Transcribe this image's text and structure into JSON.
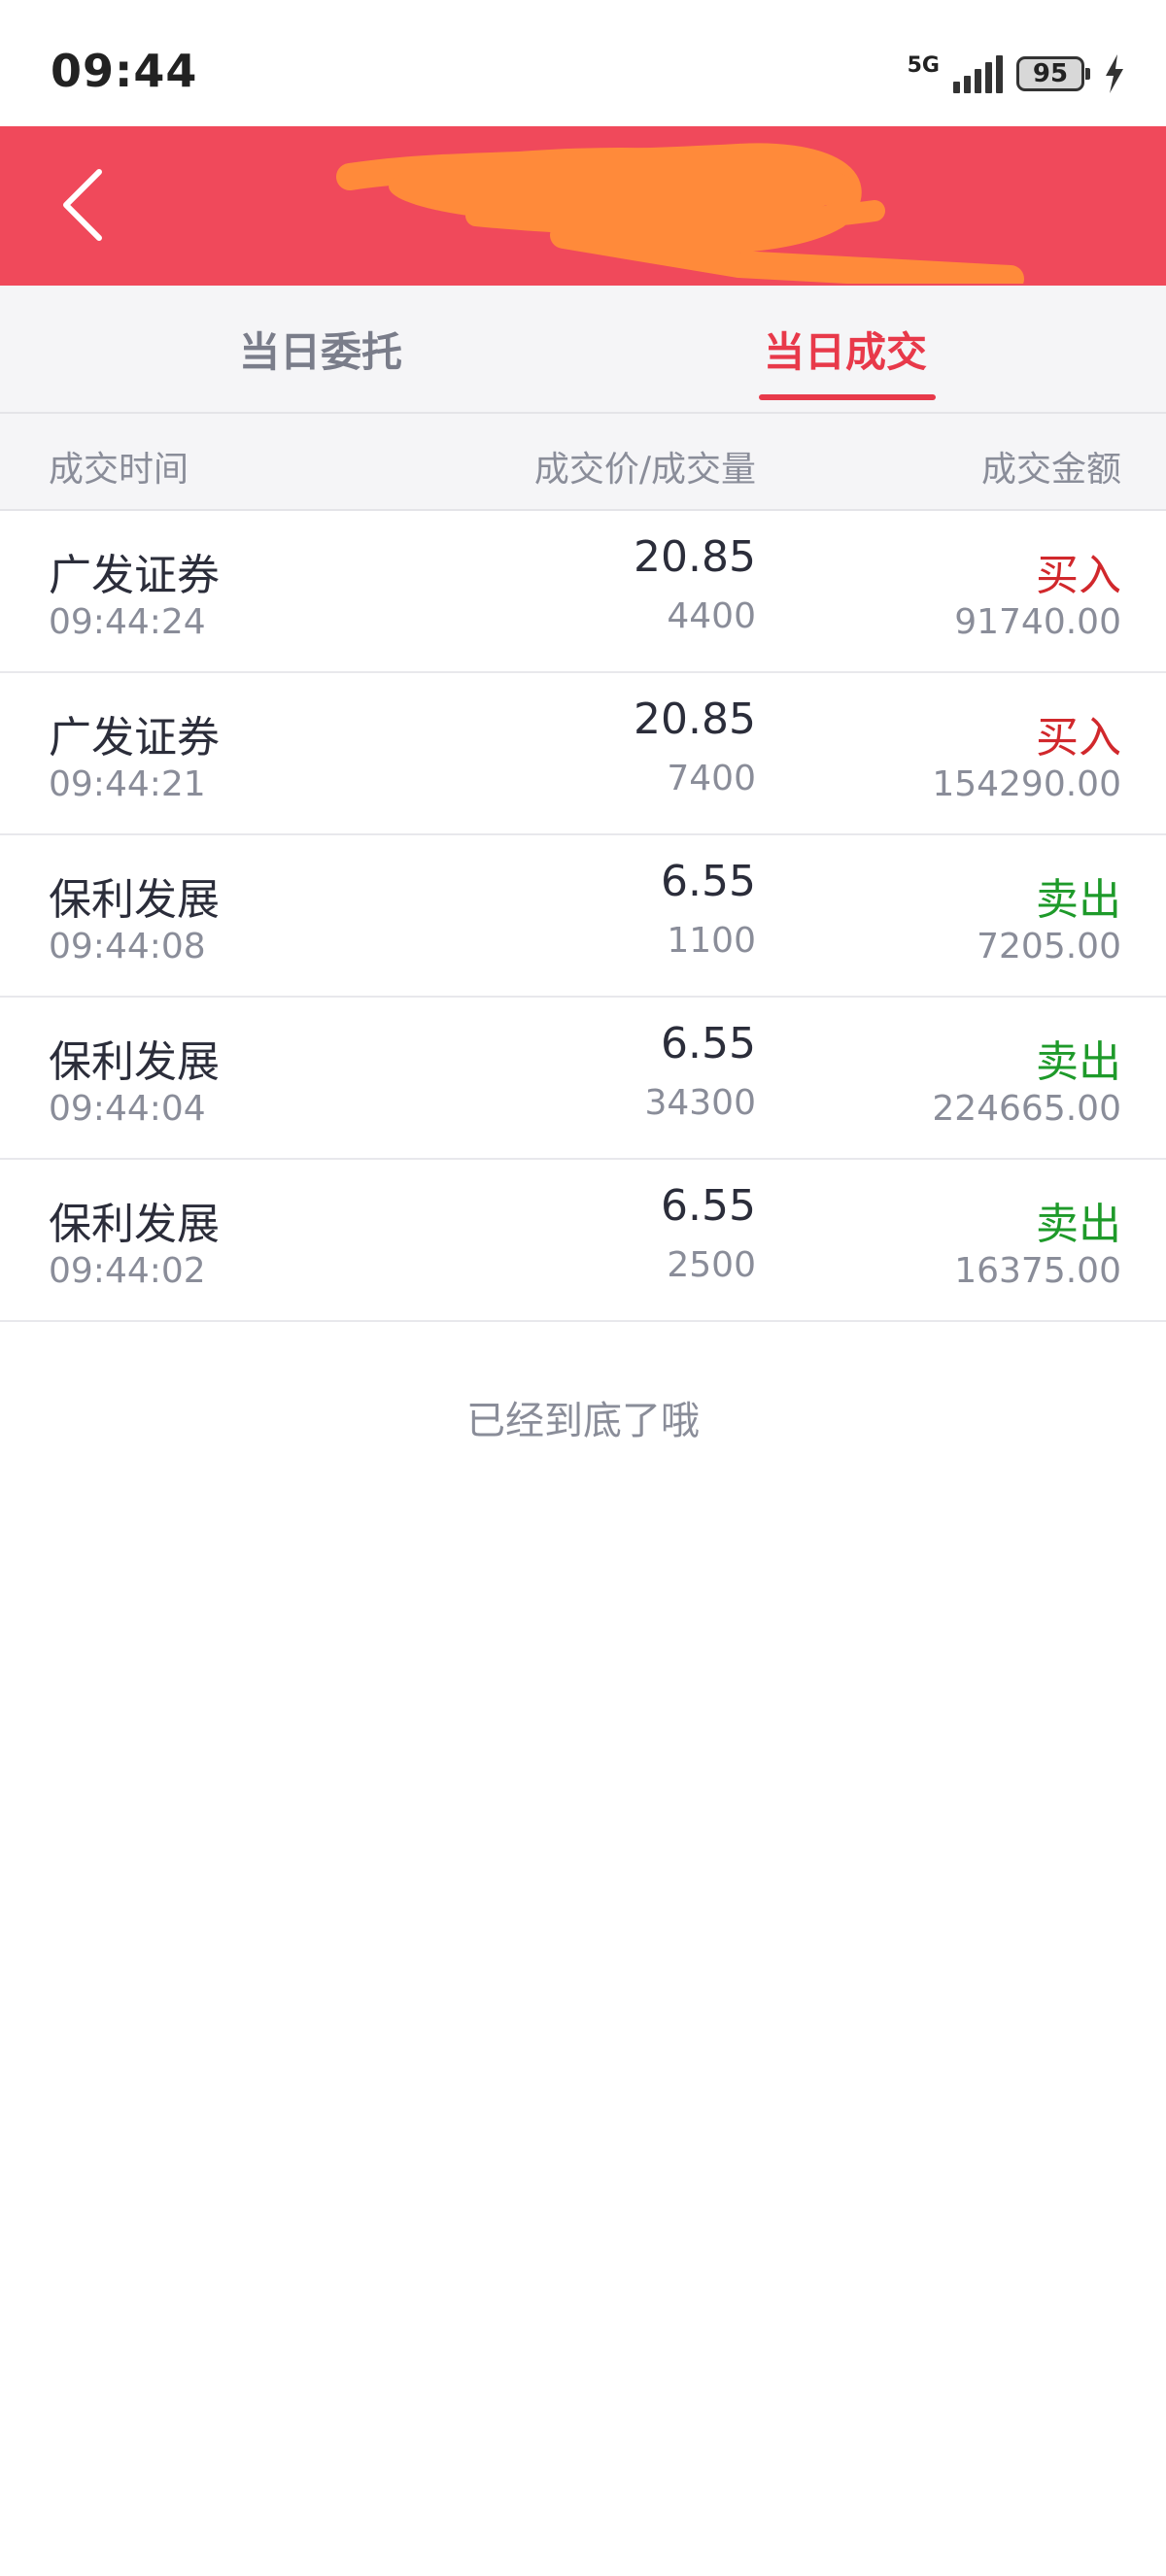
{
  "status_bar": {
    "time": "09:44",
    "network": "5G",
    "battery": "95"
  },
  "tabs": [
    {
      "label": "当日委托",
      "active": false
    },
    {
      "label": "当日成交",
      "active": true
    }
  ],
  "columns": {
    "time": "成交时间",
    "price_qty": "成交价/成交量",
    "amount": "成交金额"
  },
  "trades": [
    {
      "name": "广发证券",
      "time": "09:44:24",
      "price": "20.85",
      "qty": "4400",
      "side": "买入",
      "side_type": "buy",
      "amount": "91740.00"
    },
    {
      "name": "广发证券",
      "time": "09:44:21",
      "price": "20.85",
      "qty": "7400",
      "side": "买入",
      "side_type": "buy",
      "amount": "154290.00"
    },
    {
      "name": "保利发展",
      "time": "09:44:08",
      "price": "6.55",
      "qty": "1100",
      "side": "卖出",
      "side_type": "sell",
      "amount": "7205.00"
    },
    {
      "name": "保利发展",
      "time": "09:44:04",
      "price": "6.55",
      "qty": "34300",
      "side": "卖出",
      "side_type": "sell",
      "amount": "224665.00"
    },
    {
      "name": "保利发展",
      "time": "09:44:02",
      "price": "6.55",
      "qty": "2500",
      "side": "卖出",
      "side_type": "sell",
      "amount": "16375.00"
    }
  ],
  "footer": {
    "end_text": "已经到底了哦"
  },
  "colors": {
    "header": "#f0495b",
    "accent": "#e8394a",
    "buy": "#d1282c",
    "sell": "#1e9a2a",
    "redaction": "#ff8a3a"
  }
}
